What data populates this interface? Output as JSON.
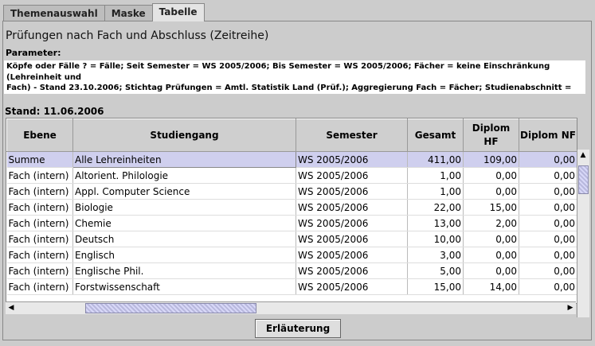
{
  "tabs": [
    "Themenauswahl",
    "Maske",
    "Tabelle"
  ],
  "title": "Prüfungen nach Fach und Abschluss (Zeitreihe)",
  "param_label": "Parameter:",
  "params": "Köpfe oder Fälle ? = Fälle; Seit Semester = WS 2005/2006; Bis Semester = WS 2005/2006; Fächer = keine Einschränkung (Lehreinheit und\nFach) - Stand 23.10.2006; Stichtag Prüfungen = Amtl. Statistik Land (Prüf.); Aggregierung Fach = Fächer; Studienabschnitt = Hauptstudium;\nPrüfungsstatus = bestanden; User=superx;",
  "stand": "Stand: 11.06.2006",
  "columns": [
    "Ebene",
    "Studiengang",
    "Semester",
    "Gesamt",
    "Diplom HF",
    "Diplom NF"
  ],
  "rows": [
    [
      "Summe",
      "Alle Lehreinheiten",
      "WS 2005/2006",
      "411,00",
      "109,00",
      "0,00"
    ],
    [
      "Fach (intern)",
      "Altorient. Philologie",
      "WS 2005/2006",
      "1,00",
      "0,00",
      "0,00"
    ],
    [
      "Fach (intern)",
      "Appl. Computer Science",
      "WS 2005/2006",
      "1,00",
      "0,00",
      "0,00"
    ],
    [
      "Fach (intern)",
      "Biologie",
      "WS 2005/2006",
      "22,00",
      "15,00",
      "0,00"
    ],
    [
      "Fach (intern)",
      "Chemie",
      "WS 2005/2006",
      "13,00",
      "2,00",
      "0,00"
    ],
    [
      "Fach (intern)",
      "Deutsch",
      "WS 2005/2006",
      "10,00",
      "0,00",
      "0,00"
    ],
    [
      "Fach (intern)",
      "Englisch",
      "WS 2005/2006",
      "3,00",
      "0,00",
      "0,00"
    ],
    [
      "Fach (intern)",
      "Englische Phil.",
      "WS 2005/2006",
      "5,00",
      "0,00",
      "0,00"
    ],
    [
      "Fach (intern)",
      "Forstwissenschaft",
      "WS 2005/2006",
      "15,00",
      "14,00",
      "0,00"
    ]
  ],
  "button": "Erläuterung"
}
